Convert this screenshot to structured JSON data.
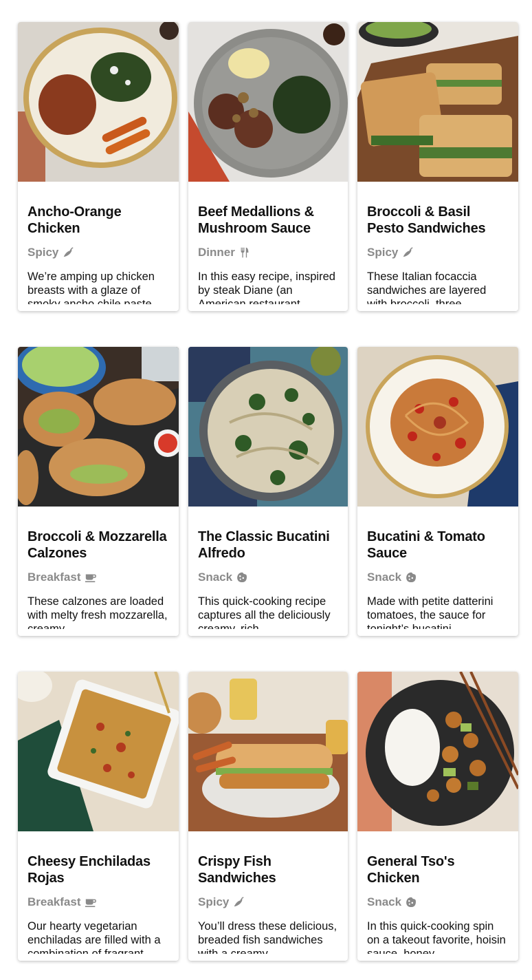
{
  "recipes": [
    {
      "title": "Ancho-Orange Chicken",
      "tag": "Spicy",
      "tag_icon": "chili-pepper-icon",
      "description": "We’re amping up chicken breasts with a glaze of smoky ancho chile paste",
      "image": "ancho-orange-chicken-photo"
    },
    {
      "title": "Beef Medallions & Mushroom Sauce",
      "tag": "Dinner",
      "tag_icon": "fork-knife-icon",
      "description": "In this easy recipe, inspired by steak Diane (an American restaurant",
      "image": "beef-medallions-photo"
    },
    {
      "title": "Broccoli & Basil Pesto Sandwiches",
      "tag": "Spicy",
      "tag_icon": "chili-pepper-icon",
      "description": "These Italian focaccia sandwiches are layered with broccoli, three",
      "image": "pesto-sandwiches-photo"
    },
    {
      "title": "Broccoli & Mozzarella Calzones",
      "tag": "Breakfast",
      "tag_icon": "coffee-cup-icon",
      "description": "These calzones are loaded with melty fresh mozzarella, creamy",
      "image": "calzones-photo"
    },
    {
      "title": "The Classic Bucatini Alfredo",
      "tag": "Snack",
      "tag_icon": "cookie-icon",
      "description": "This quick-cooking recipe captures all the deliciously creamy, rich",
      "image": "bucatini-alfredo-photo"
    },
    {
      "title": "Bucatini & Tomato Sauce",
      "tag": "Snack",
      "tag_icon": "cookie-icon",
      "description": "Made with petite datterini tomatoes, the sauce for tonight’s bucatini",
      "image": "bucatini-tomato-photo"
    },
    {
      "title": "Cheesy Enchiladas Rojas",
      "tag": "Breakfast",
      "tag_icon": "coffee-cup-icon",
      "description": "Our hearty vegetarian enchiladas are filled with a combination of fragrant,",
      "image": "enchiladas-photo"
    },
    {
      "title": "Crispy Fish Sandwiches",
      "tag": "Spicy",
      "tag_icon": "chili-pepper-icon",
      "description": "You’ll dress these delicious, breaded fish sandwiches with a creamy,",
      "image": "fish-sandwich-photo"
    },
    {
      "title": "General Tso's Chicken",
      "tag": "Snack",
      "tag_icon": "cookie-icon",
      "description": "In this quick-cooking spin on a takeout favorite, hoisin sauce, honey,",
      "image": "general-tso-photo"
    }
  ],
  "colors": {
    "tag": "#8a8a8a",
    "title": "#111111",
    "card_bg": "#ffffff"
  }
}
